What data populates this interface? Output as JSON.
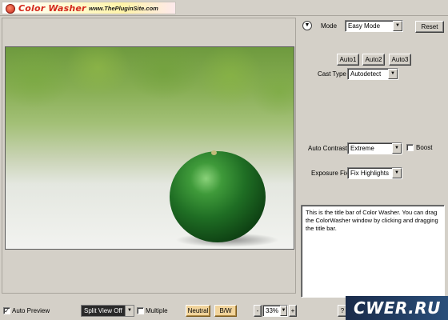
{
  "title_bar": {
    "app_title": "Color Washer",
    "url": "www.ThePluginSite.com"
  },
  "mode": {
    "label": "Mode",
    "value": "Easy Mode",
    "reset_label": "Reset"
  },
  "auto_buttons": [
    "Auto1",
    "Auto2",
    "Auto3"
  ],
  "cast_type": {
    "label": "Cast Type",
    "value": "Autodetect"
  },
  "auto_contrast": {
    "label": "Auto Contrast",
    "value": "Extreme",
    "boost_label": "Boost",
    "boost_checked": false
  },
  "exposure_fix": {
    "label": "Exposure Fix",
    "value": "Fix Highlights"
  },
  "help_text": "This is the title bar of Color Washer. You can drag the ColorWasher window by clicking and dragging the title bar.",
  "bottom_bar": {
    "auto_preview_label": "Auto Preview",
    "auto_preview_checked": true,
    "split_view_value": "Split View Off",
    "multiple_label": "Multiple",
    "multiple_checked": false,
    "neutral_label": "Neutral",
    "bw_label": "B/W",
    "zoom_minus": "-",
    "zoom_value": "33%",
    "zoom_plus": "+",
    "help_button": "?"
  },
  "watermark_text": "CWER.RU"
}
